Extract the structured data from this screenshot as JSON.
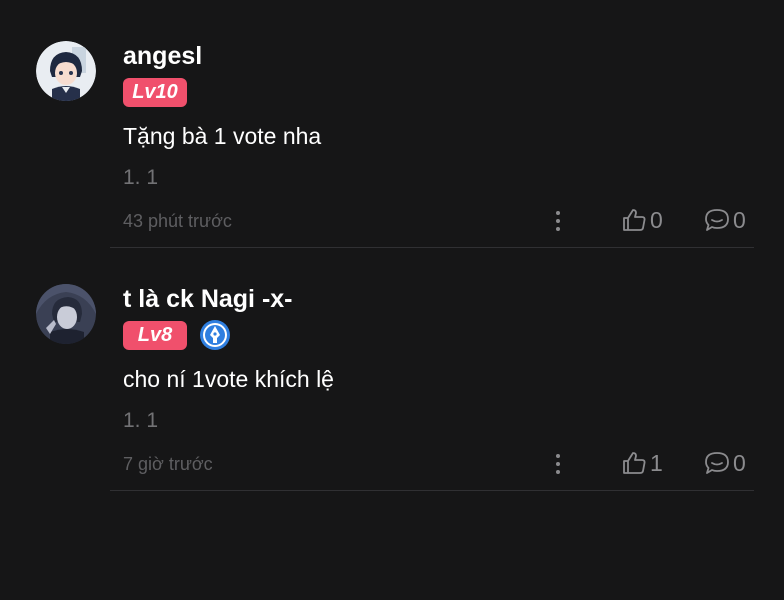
{
  "comments": [
    {
      "username": "angesl",
      "level": "Lv10",
      "has_verify_badge": false,
      "text": "Tặng bà 1 vote nha",
      "sub": "1. 1",
      "time": "43 phút trước",
      "likes": "0",
      "replies": "0",
      "avatar_icon": "anime-boy-avatar"
    },
    {
      "username": "t là ck Nagi -x-",
      "level": "Lv8",
      "has_verify_badge": true,
      "text": "cho ní 1vote khích lệ",
      "sub": "1. 1",
      "time": "7 giờ trước",
      "likes": "1",
      "replies": "0",
      "avatar_icon": "anime-portrait-avatar"
    }
  ],
  "icons": {
    "more": "more-vertical-icon",
    "like": "thumbs-up-icon",
    "reply": "comment-bubble-icon",
    "verify": "pen-nib-badge-icon"
  },
  "colors": {
    "background": "#161617",
    "level_badge": "#f0506c",
    "verify_badge": "#2f7fe0",
    "muted_text": "#727275",
    "divider": "#303033"
  }
}
